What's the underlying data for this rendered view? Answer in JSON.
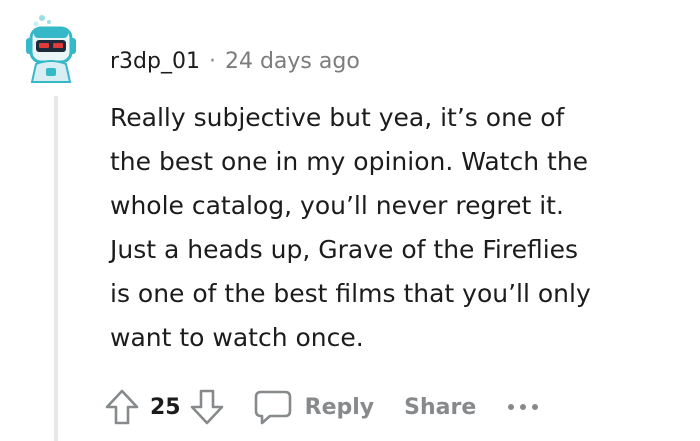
{
  "comment": {
    "username": "r3dp_01",
    "separator": "·",
    "timestamp": "24 days ago",
    "avatar_icon": "robot-avatar-icon",
    "body_lines": [
      "Really subjective but yea, it’s one of",
      "the best one in my opinion. Watch the",
      "whole catalog, you’ll never regret it.",
      "Just a heads up, Grave of the Fireflies",
      "is one of the best films that you’ll only",
      "want to watch once."
    ]
  },
  "actions": {
    "upvote_icon": "upvote-arrow-icon",
    "score": "25",
    "downvote_icon": "downvote-arrow-icon",
    "reply_icon": "speech-bubble-icon",
    "reply_label": "Reply",
    "share_label": "Share",
    "more_icon": "more-dots-icon"
  },
  "colors": {
    "text": "#1c1c1c",
    "muted": "#878a8c",
    "thread_line": "#e8e8e8",
    "avatar_teal": "#35b8c8",
    "avatar_dark": "#1d2b3a"
  }
}
